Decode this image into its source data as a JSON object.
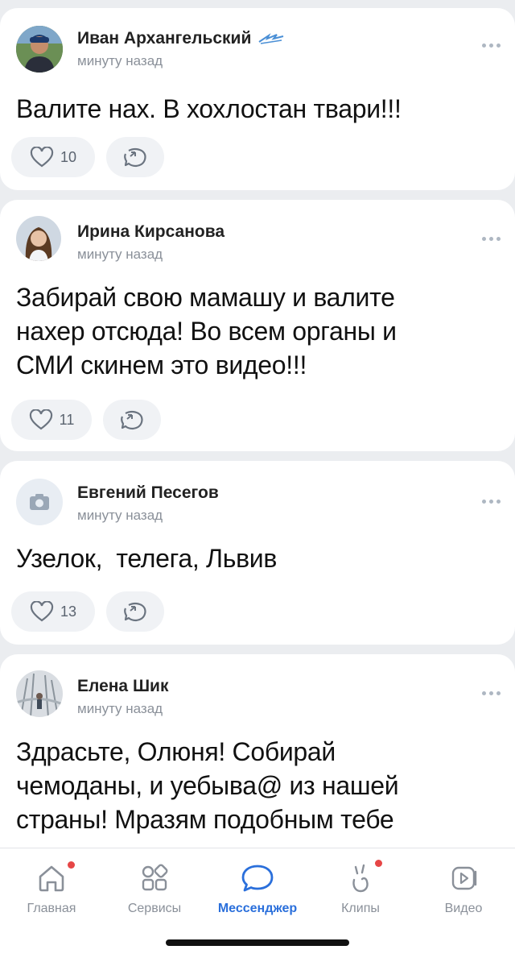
{
  "posts": [
    {
      "author": "Иван Архангельский",
      "time": "минуту назад",
      "text": "Валите нах. В хохлостан твари!!!",
      "likes": "10",
      "avatar_icon": "user-photo"
    },
    {
      "author": "Ирина Кирсанова",
      "time": "минуту назад",
      "text": "Забирай свою мамашу и валите нахер отсюда! Во всем органы и СМИ скинем это видео!!!",
      "likes": "11",
      "avatar_icon": "user-photo"
    },
    {
      "author": "Евгений Песегов",
      "time": "минуту назад",
      "text": "Узелок,  телега, Львив",
      "likes": "13",
      "avatar_icon": "camera-placeholder-icon"
    },
    {
      "author": "Елена Шик",
      "time": "минуту назад",
      "text": "Здрасьте, Олюня! Собирай чемоданы, и уебыва@ из нашей страны! Мразям подобным тебе",
      "avatar_icon": "user-photo"
    }
  ],
  "tabbar": {
    "items": [
      {
        "label": "Главная",
        "icon": "home-icon",
        "badge": true
      },
      {
        "label": "Сервисы",
        "icon": "grid-icon",
        "badge": false
      },
      {
        "label": "Мессенджер",
        "icon": "chat-icon",
        "badge": false,
        "active": true
      },
      {
        "label": "Клипы",
        "icon": "clips-icon",
        "badge": true
      },
      {
        "label": "Видео",
        "icon": "video-icon",
        "badge": false
      }
    ]
  },
  "colors": {
    "accent": "#2a6fdb",
    "badge": "#e64646",
    "background": "#ebedf0"
  }
}
